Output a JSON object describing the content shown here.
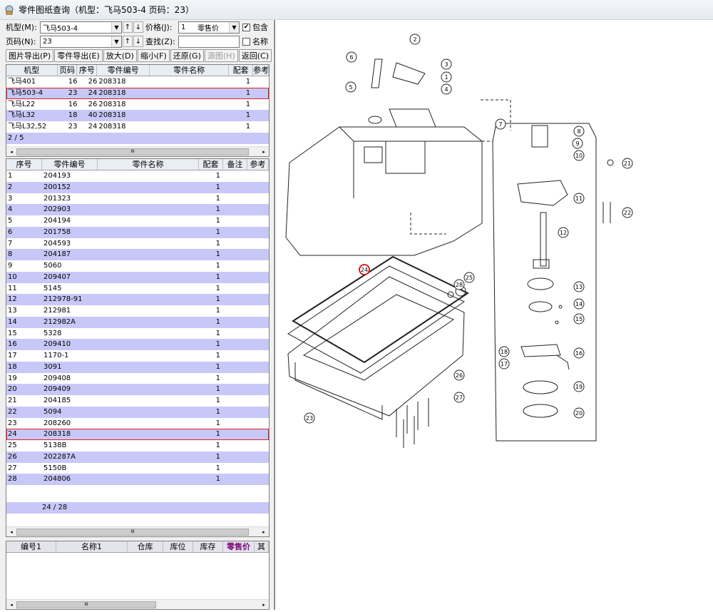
{
  "window": {
    "title": "零件图纸查询（机型：飞马503-4 页码：23）",
    "icon": "app-icon"
  },
  "controls": {
    "model_label": "机型(M):",
    "model_value": "飞马503-4",
    "page_label": "页码(N):",
    "page_value": "23",
    "price_label": "价格(J):",
    "price_qty": "1",
    "price_type": "零售价",
    "include_label": "包含",
    "include_checked": true,
    "search_label": "查找(Z):",
    "search_value": "",
    "name_label": "名称",
    "name_checked": false,
    "up_glyph": "↑",
    "down_glyph": "↓"
  },
  "toolbar": [
    {
      "name": "export-image-button",
      "label": "图片导出(P)",
      "disabled": false
    },
    {
      "name": "export-parts-button",
      "label": "零件导出(E)",
      "disabled": false
    },
    {
      "name": "zoom-in-button",
      "label": "放大(D)",
      "disabled": false
    },
    {
      "name": "zoom-out-button",
      "label": "缩小(F)",
      "disabled": false
    },
    {
      "name": "restore-button",
      "label": "还原(G)",
      "disabled": false
    },
    {
      "name": "source-image-button",
      "label": "源图(H)",
      "disabled": true
    },
    {
      "name": "back-button",
      "label": "返回(C)",
      "disabled": false
    }
  ],
  "models_grid": {
    "headers": [
      "机型",
      "页码",
      "序号",
      "零件编号",
      "零件名称",
      "配套",
      "参考"
    ],
    "rows": [
      [
        "飞马401",
        "16",
        "26",
        "208318",
        "",
        "1",
        ""
      ],
      [
        "飞马503-4",
        "23",
        "24",
        "208318",
        "",
        "1",
        ""
      ],
      [
        "飞马L22",
        "16",
        "26",
        "208318",
        "",
        "1",
        ""
      ],
      [
        "飞马L32",
        "18",
        "40",
        "208318",
        "",
        "1",
        ""
      ],
      [
        "飞马L32,52",
        "23",
        "24",
        "208318",
        "",
        "1",
        ""
      ]
    ],
    "selected_index": 1,
    "footer": "2 / 5"
  },
  "parts_grid": {
    "headers": [
      "序号",
      "零件编号",
      "零件名称",
      "配套",
      "备注",
      "参考"
    ],
    "rows": [
      [
        "1",
        "204193",
        "",
        "1",
        "",
        ""
      ],
      [
        "2",
        "200152",
        "",
        "1",
        "",
        ""
      ],
      [
        "3",
        "201323",
        "",
        "1",
        "",
        ""
      ],
      [
        "4",
        "202903",
        "",
        "1",
        "",
        ""
      ],
      [
        "5",
        "204194",
        "",
        "1",
        "",
        ""
      ],
      [
        "6",
        "201758",
        "",
        "1",
        "",
        ""
      ],
      [
        "7",
        "204593",
        "",
        "1",
        "",
        ""
      ],
      [
        "8",
        "204187",
        "",
        "1",
        "",
        ""
      ],
      [
        "9",
        "5060",
        "",
        "1",
        "",
        ""
      ],
      [
        "10",
        "209407",
        "",
        "1",
        "",
        ""
      ],
      [
        "11",
        "5145",
        "",
        "1",
        "",
        ""
      ],
      [
        "12",
        "212978-91",
        "",
        "1",
        "",
        ""
      ],
      [
        "13",
        "212981",
        "",
        "1",
        "",
        ""
      ],
      [
        "14",
        "212982A",
        "",
        "1",
        "",
        ""
      ],
      [
        "15",
        "5328",
        "",
        "1",
        "",
        ""
      ],
      [
        "16",
        "209410",
        "",
        "1",
        "",
        ""
      ],
      [
        "17",
        "1170-1",
        "",
        "1",
        "",
        ""
      ],
      [
        "18",
        "3091",
        "",
        "1",
        "",
        ""
      ],
      [
        "19",
        "209408",
        "",
        "1",
        "",
        ""
      ],
      [
        "20",
        "209409",
        "",
        "1",
        "",
        ""
      ],
      [
        "21",
        "204185",
        "",
        "1",
        "",
        ""
      ],
      [
        "22",
        "5094",
        "",
        "1",
        "",
        ""
      ],
      [
        "23",
        "208260",
        "",
        "1",
        "",
        ""
      ],
      [
        "24",
        "208318",
        "",
        "1",
        "",
        ""
      ],
      [
        "25",
        "5138B",
        "",
        "1",
        "",
        ""
      ],
      [
        "26",
        "202287A",
        "",
        "1",
        "",
        ""
      ],
      [
        "27",
        "5150B",
        "",
        "1",
        "",
        ""
      ],
      [
        "28",
        "204806",
        "",
        "1",
        "",
        ""
      ]
    ],
    "selected_index": 23,
    "footer": "24 / 28"
  },
  "stock_grid": {
    "headers": [
      "编号1",
      "名称1",
      "仓库",
      "库位",
      "库存",
      "零售价",
      "其"
    ],
    "accent_header_index": 5,
    "accent_color": "#7a0a7a"
  },
  "diagram": {
    "callouts": [
      "1",
      "2",
      "3",
      "4",
      "5",
      "6",
      "7",
      "8",
      "9",
      "10",
      "11",
      "12",
      "13",
      "14",
      "15",
      "16",
      "17",
      "18",
      "19",
      "20",
      "21",
      "22",
      "23",
      "24",
      "25",
      "26",
      "27",
      "28"
    ],
    "highlight_callout": "24",
    "highlight_color": "#d01010"
  },
  "scroll_thumb_glyph": "III",
  "scroll_left_glyph": "◂",
  "scroll_right_glyph": "▸"
}
